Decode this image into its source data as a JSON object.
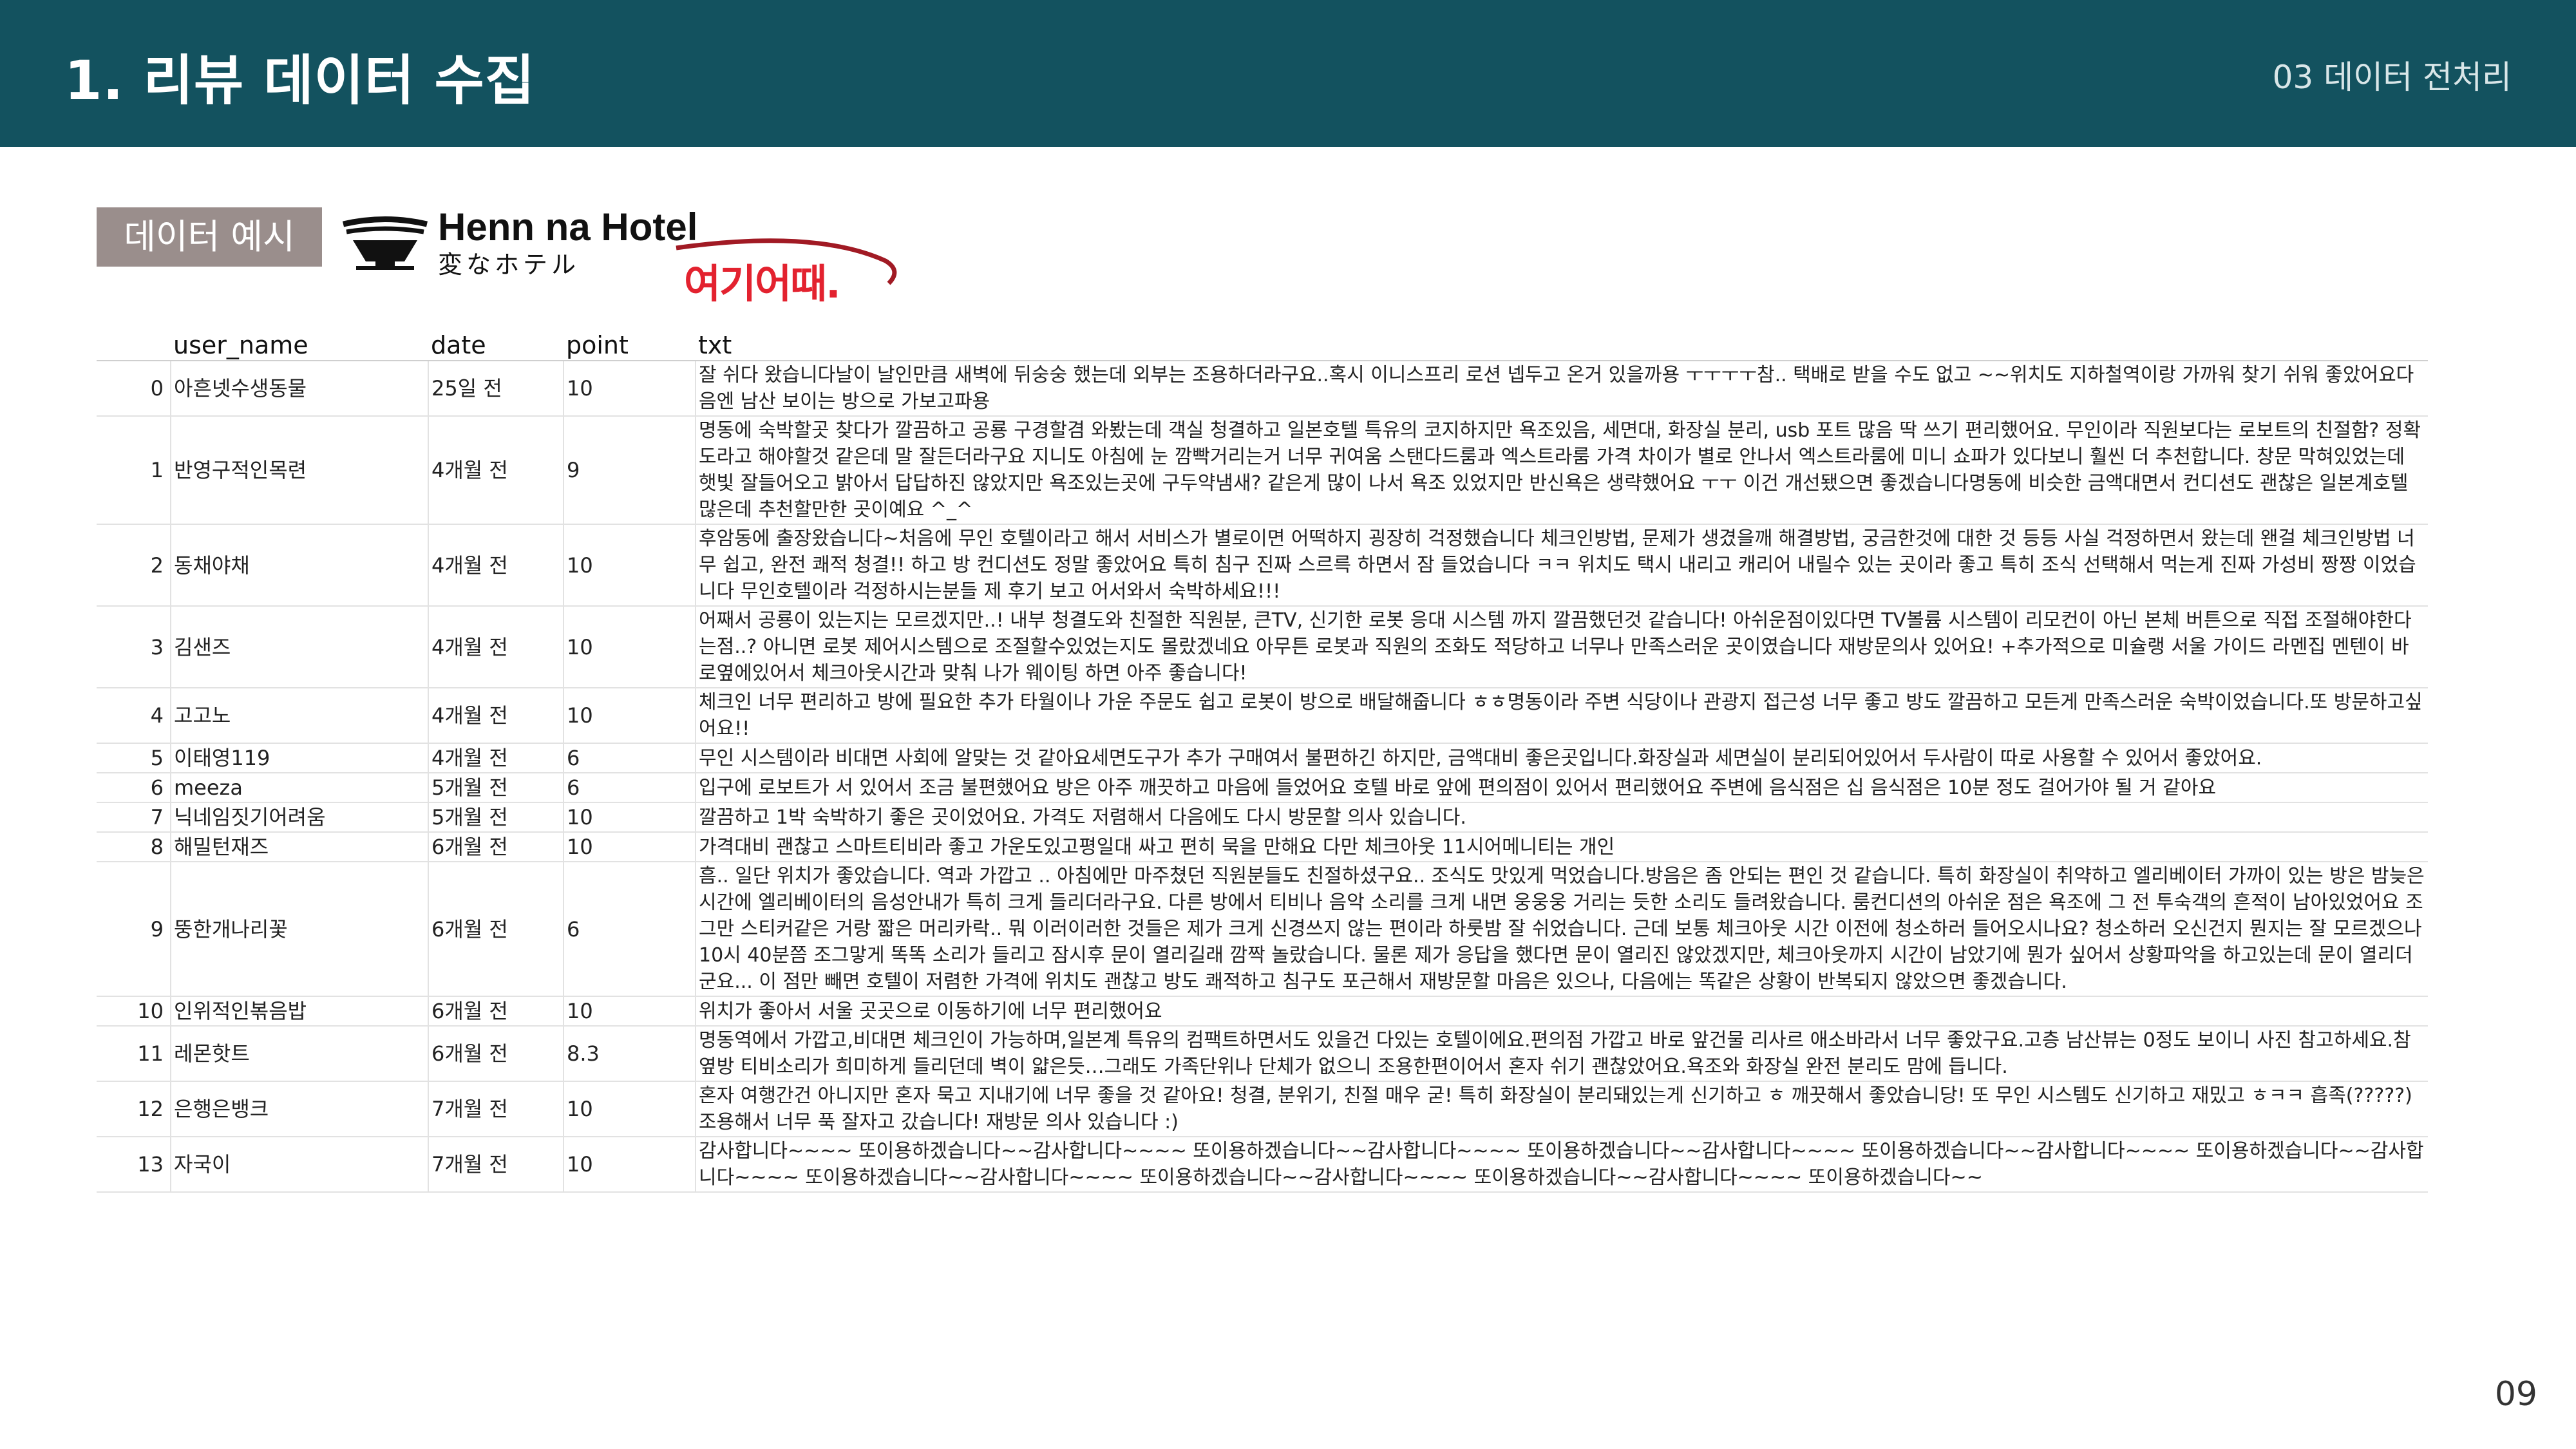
{
  "header": {
    "title": "1. 리뷰 데이터 수집",
    "section": "03 데이터 전처리"
  },
  "badge": "데이터 예시",
  "logos": {
    "hotel_name": "Henn na Hotel",
    "hotel_sub": "変なホテル",
    "yeogi": "여기어때."
  },
  "table": {
    "columns": [
      "",
      "user_name",
      "date",
      "point",
      "txt"
    ],
    "rows": [
      {
        "idx": "0",
        "user": "아흔넷수생동물",
        "date": "25일 전",
        "point": "10",
        "txt": "잘 쉬다 왔습니다날이 날인만큼 새벽에 뒤숭숭 했는데 외부는 조용하더라구요..혹시 이니스프리 로션 넵두고 온거 있을까용 ㅜㅜㅜㅜ참.. 택배로 받을 수도 없고 ~~위치도 지하철역이랑 가까워 찾기 쉬워 좋았어요다음엔 남산 보이는 방으로 가보고파용"
      },
      {
        "idx": "1",
        "user": "반영구적인목련",
        "date": "4개월 전",
        "point": "9",
        "txt": "명동에 숙박할곳 찾다가 깔끔하고 공룡 구경할겸 와봤는데 객실 청결하고 일본호텔 특유의 코지하지만 욕조있음, 세면대, 화장실 분리, usb 포트 많음 딱 쓰기 편리했어요. 무인이라 직원보다는 로보트의 친절함? 정확도라고 해야할것 같은데 말 잘든더라구요 지니도 아침에 눈 깜빡거리는거 너무 귀여움 스탠다드룸과 엑스트라룸 가격 차이가 별로 안나서 엑스트라룸에 미니 쇼파가 있다보니 훨씬 더 추천합니다. 창문 막혀있었는데 햇빛 잘들어오고 밝아서 답답하진 않았지만 욕조있는곳에 구두약냄새? 같은게 많이 나서 욕조 있었지만 반신욕은 생략했어요 ㅜㅜ 이건 개선됐으면 좋겠습니다명동에 비슷한 금액대면서 컨디션도 괜찮은 일본계호텔 많은데 추천할만한 곳이예요 ^_^"
      },
      {
        "idx": "2",
        "user": "동채야채",
        "date": "4개월 전",
        "point": "10",
        "txt": "후암동에 출장왔습니다~처음에 무인 호텔이라고 해서 서비스가 별로이면 어떡하지 굉장히 걱정했습니다 체크인방법, 문제가 생겼을깨 해결방법, 궁금한것에 대한 것 등등 사실 걱정하면서 왔는데 왠걸 체크인방법 너무 쉽고, 완전 쾌적 청결!! 하고 방 컨디션도 정말 좋았어요 특히 침구 진짜 스르륵 하면서 잠 들었습니다 ㅋㅋ 위치도 택시 내리고 캐리어 내릴수 있는 곳이라 좋고 특히 조식 선택해서 먹는게 진짜 가성비 짱짱 이었습니다 무인호텔이라 걱정하시는분들 제 후기 보고 어서와서 숙박하세요!!!"
      },
      {
        "idx": "3",
        "user": "김샌즈",
        "date": "4개월 전",
        "point": "10",
        "txt": "어째서 공룡이 있는지는 모르겠지만..! 내부 청결도와 친절한 직원분, 큰TV, 신기한 로봇 응대 시스템 까지 깔끔했던것 같습니다! 아쉬운점이있다면 TV볼륨 시스템이 리모컨이 아닌 본체 버튼으로 직접 조절해야한다는점..? 아니면 로봇 제어시스템으로 조절할수있었는지도 몰랐겠네요 아무튼 로봇과 직원의 조화도 적당하고 너무나 만족스러운 곳이였습니다 재방문의사 있어요! +추가적으로 미슐랭 서울 가이드 라멘집 멘텐이 바로옆에있어서 체크아웃시간과 맞춰 나가 웨이팅 하면 아주 좋습니다!"
      },
      {
        "idx": "4",
        "user": "고고노",
        "date": "4개월 전",
        "point": "10",
        "txt": "체크인 너무 편리하고 방에 필요한 추가 타월이나 가운 주문도 쉽고 로봇이 방으로 배달해줍니다 ㅎㅎ명동이라 주변 식당이나 관광지 접근성 너무 좋고 방도 깔끔하고 모든게 만족스러운 숙박이었습니다.또 방문하고싶어요!!"
      },
      {
        "idx": "5",
        "user": "이태영119",
        "date": "4개월 전",
        "point": "6",
        "txt": "무인 시스템이라 비대면 사회에 알맞는 것 같아요세면도구가 추가 구매여서 불편하긴 하지만, 금액대비 좋은곳입니다.화장실과 세면실이 분리되어있어서 두사람이 따로 사용할 수 있어서 좋았어요."
      },
      {
        "idx": "6",
        "user": "meeza",
        "date": "5개월 전",
        "point": "6",
        "txt": "입구에 로보트가 서 있어서 조금 불편했어요 방은 아주 깨끗하고 마음에 들었어요 호텔 바로 앞에 편의점이 있어서 편리했어요 주변에 음식점은 십 음식점은 10분 정도 걸어가야 될 거 같아요"
      },
      {
        "idx": "7",
        "user": "닉네임짓기어려움",
        "date": "5개월 전",
        "point": "10",
        "txt": "깔끔하고 1박 숙박하기 좋은 곳이었어요. 가격도 저렴해서 다음에도 다시 방문할 의사 있습니다."
      },
      {
        "idx": "8",
        "user": "해밀턴재즈",
        "date": "6개월 전",
        "point": "10",
        "txt": "가격대비 괜찮고 스마트티비라 좋고 가운도있고평일대 싸고 편히 묵을 만해요 다만 체크아웃 11시어메니티는 개인"
      },
      {
        "idx": "9",
        "user": "뚱한개나리꽃",
        "date": "6개월 전",
        "point": "6",
        "txt": "흠.. 일단 위치가 좋았습니다. 역과 가깝고 .. 아침에만 마주쳤던 직원분들도 친절하셨구요.. 조식도 맛있게 먹었습니다.방음은 좀 안되는 편인 것 같습니다. 특히 화장실이 취약하고 엘리베이터 가까이 있는 방은 밤늦은 시간에 엘리베이터의 음성안내가 특히 크게 들리더라구요. 다른 방에서 티비나 음악 소리를 크게 내면 웅웅웅 거리는 듯한 소리도 들려왔습니다. 룸컨디션의 아쉬운 점은 욕조에 그 전 투숙객의 흔적이 남아있었어요 조그만 스티커같은 거랑 짧은 머리카락.. 뭐 이러이러한 것들은 제가 크게 신경쓰지 않는 편이라 하룻밤 잘 쉬었습니다. 근데 보통 체크아웃 시간 이전에 청소하러 들어오시나요? 청소하러 오신건지 뭔지는 잘 모르겠으나 10시 40분쯤 조그맣게 똑똑 소리가 들리고 잠시후 문이 열리길래 깜짝 놀랐습니다. 물론 제가 응답을 했다면 문이 열리진 않았겠지만, 체크아웃까지 시간이 남았기에 뭔가 싶어서 상황파악을 하고있는데 문이 열리더군요... 이 점만 빼면 호텔이 저렴한 가격에 위치도 괜찮고 방도 쾌적하고 침구도 포근해서 재방문할 마음은 있으나, 다음에는 똑같은 상황이 반복되지 않았으면 좋겠습니다."
      },
      {
        "idx": "10",
        "user": "인위적인볶음밥",
        "date": "6개월 전",
        "point": "10",
        "txt": "위치가 좋아서 서울 곳곳으로 이동하기에 너무 편리했어요"
      },
      {
        "idx": "11",
        "user": "레몬핫트",
        "date": "6개월 전",
        "point": "8.3",
        "txt": "명동역에서 가깝고,비대면 체크인이 가능하며,일본계 특유의 컴팩트하면서도 있을건 다있는 호텔이에요.편의점 가깝고 바로 앞건물 리사르 애소바라서 너무 좋았구요.고층 남산뷰는 0정도 보이니 사진 참고하세요.참 옆방 티비소리가 희미하게 들리던데 벽이 얇은듯…그래도 가족단위나 단체가 없으니 조용한편이어서 혼자 쉬기 괜찮았어요.욕조와 화장실 완전 분리도 맘에 듭니다."
      },
      {
        "idx": "12",
        "user": "은행은뱅크",
        "date": "7개월 전",
        "point": "10",
        "txt": "혼자 여행간건 아니지만 혼자 묵고 지내기에 너무 좋을 것 같아요! 청결, 분위기, 친절 매우 굳! 특히 화장실이 분리돼있는게 신기하고 ㅎ 깨끗해서 좋았습니당! 또 무인 시스템도 신기하고 재밌고 ㅎㅋㅋ 흡족(?????) 조용해서 너무 푹 잘자고 갔습니다! 재방문 의사 있습니다 :)"
      },
      {
        "idx": "13",
        "user": "자국이",
        "date": "7개월 전",
        "point": "10",
        "txt": "감사합니다~~~~ 또이용하겠습니다~~감사합니다~~~~ 또이용하겠습니다~~감사합니다~~~~ 또이용하겠습니다~~감사합니다~~~~ 또이용하겠습니다~~감사합니다~~~~ 또이용하겠습니다~~감사합니다~~~~ 또이용하겠습니다~~감사합니다~~~~ 또이용하겠습니다~~감사합니다~~~~ 또이용하겠습니다~~감사합니다~~~~ 또이용하겠습니다~~"
      }
    ]
  },
  "page_number": "09",
  "colors": {
    "header_bg": "#13525f",
    "badge_bg": "#9a8e8c",
    "yeogi_red": "#e3222f"
  }
}
